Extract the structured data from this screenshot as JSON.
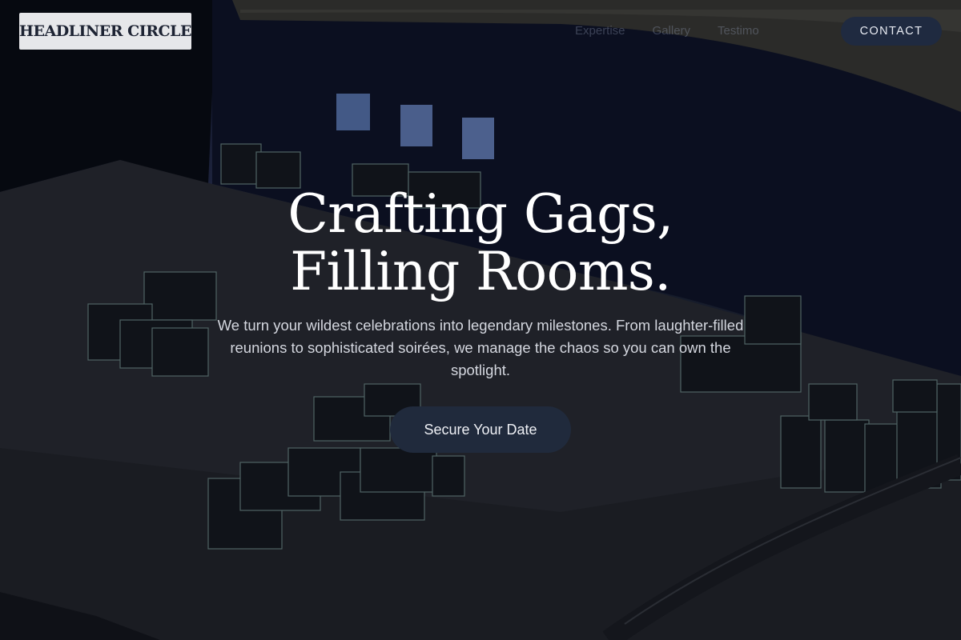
{
  "header": {
    "logo_text": "HEADLINER CIRCLE",
    "nav": [
      {
        "label": "Expertise"
      },
      {
        "label": "Gallery"
      },
      {
        "label": "Testimo"
      }
    ],
    "contact_label": "CONTACT"
  },
  "hero": {
    "headline_line1": "Crafting Gags,",
    "headline_line2": "Filling Rooms.",
    "subtext": "We turn your wildest celebrations into legendary milestones. From laughter-filled reunions to sophisticated soirées, we manage the chaos so you can own the spotlight.",
    "cta_label": "Secure Your Date"
  },
  "colors": {
    "accent": "#202a3c",
    "logo_bg": "#e6e7ea",
    "text_primary": "#ffffff"
  }
}
